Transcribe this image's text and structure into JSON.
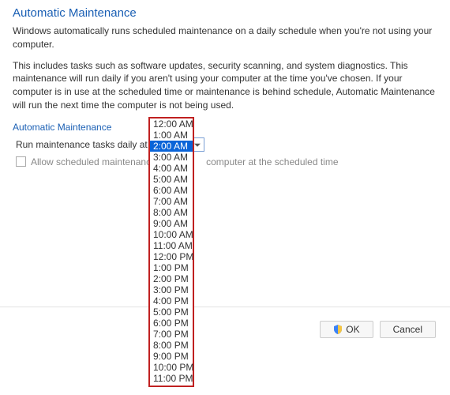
{
  "section_title": "Automatic Maintenance",
  "desc1": "Windows automatically runs scheduled maintenance on a daily schedule when you're not using your computer.",
  "desc2": "This includes tasks such as software updates, security scanning, and system diagnostics. This maintenance will run daily if you aren't using your computer at the time you've chosen. If your computer is in use at the scheduled time or maintenance is behind schedule, Automatic Maintenance will run the next time the computer is not being used.",
  "group_label": "Automatic Maintenance",
  "run_label": "Run maintenance tasks daily at",
  "selected_time": "2:00 AM",
  "wake_label_part1": "Allow scheduled maintenanc",
  "wake_label_part2": "computer at the scheduled time",
  "time_options": [
    "12:00 AM",
    "1:00 AM",
    "2:00 AM",
    "3:00 AM",
    "4:00 AM",
    "5:00 AM",
    "6:00 AM",
    "7:00 AM",
    "8:00 AM",
    "9:00 AM",
    "10:00 AM",
    "11:00 AM",
    "12:00 PM",
    "1:00 PM",
    "2:00 PM",
    "3:00 PM",
    "4:00 PM",
    "5:00 PM",
    "6:00 PM",
    "7:00 PM",
    "8:00 PM",
    "9:00 PM",
    "10:00 PM",
    "11:00 PM"
  ],
  "highlighted_option": "2:00 AM",
  "buttons": {
    "ok": "OK",
    "cancel": "Cancel"
  }
}
